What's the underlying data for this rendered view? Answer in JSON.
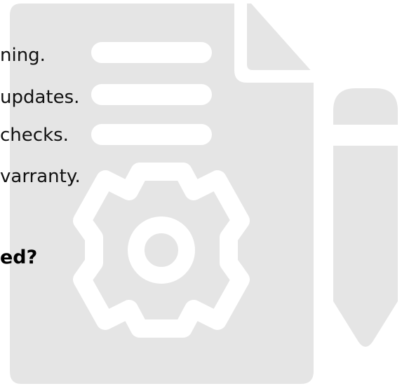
{
  "list": {
    "items": [
      "ning.",
      " updates.",
      "checks.",
      "varranty."
    ]
  },
  "question": "ed?",
  "colors": {
    "illustration_fill": "#e5e5e5",
    "illustration_cutout": "#ffffff",
    "text": "#111111"
  },
  "icons": [
    "document-icon",
    "gear-icon",
    "pencil-icon"
  ]
}
